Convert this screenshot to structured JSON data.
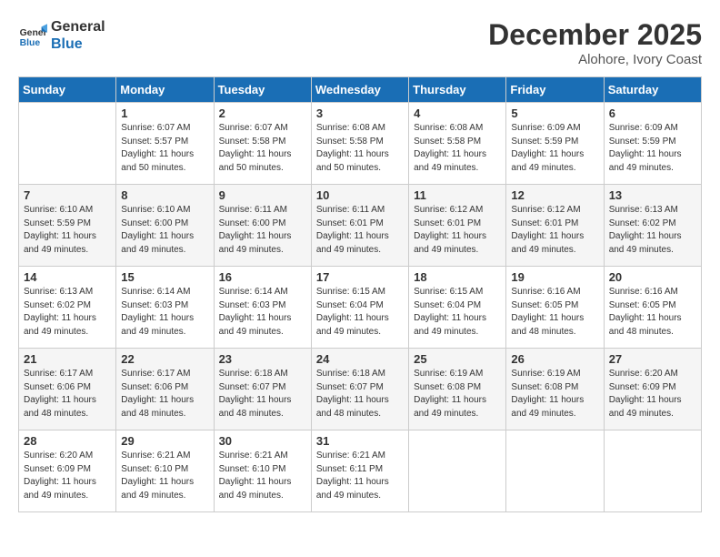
{
  "header": {
    "logo_line1": "General",
    "logo_line2": "Blue",
    "month": "December 2025",
    "location": "Alohore, Ivory Coast"
  },
  "days_of_week": [
    "Sunday",
    "Monday",
    "Tuesday",
    "Wednesday",
    "Thursday",
    "Friday",
    "Saturday"
  ],
  "weeks": [
    [
      {
        "day": "",
        "sunrise": "",
        "sunset": "",
        "daylight": ""
      },
      {
        "day": "1",
        "sunrise": "Sunrise: 6:07 AM",
        "sunset": "Sunset: 5:57 PM",
        "daylight": "Daylight: 11 hours and 50 minutes."
      },
      {
        "day": "2",
        "sunrise": "Sunrise: 6:07 AM",
        "sunset": "Sunset: 5:58 PM",
        "daylight": "Daylight: 11 hours and 50 minutes."
      },
      {
        "day": "3",
        "sunrise": "Sunrise: 6:08 AM",
        "sunset": "Sunset: 5:58 PM",
        "daylight": "Daylight: 11 hours and 50 minutes."
      },
      {
        "day": "4",
        "sunrise": "Sunrise: 6:08 AM",
        "sunset": "Sunset: 5:58 PM",
        "daylight": "Daylight: 11 hours and 49 minutes."
      },
      {
        "day": "5",
        "sunrise": "Sunrise: 6:09 AM",
        "sunset": "Sunset: 5:59 PM",
        "daylight": "Daylight: 11 hours and 49 minutes."
      },
      {
        "day": "6",
        "sunrise": "Sunrise: 6:09 AM",
        "sunset": "Sunset: 5:59 PM",
        "daylight": "Daylight: 11 hours and 49 minutes."
      }
    ],
    [
      {
        "day": "7",
        "sunrise": "Sunrise: 6:10 AM",
        "sunset": "Sunset: 5:59 PM",
        "daylight": "Daylight: 11 hours and 49 minutes."
      },
      {
        "day": "8",
        "sunrise": "Sunrise: 6:10 AM",
        "sunset": "Sunset: 6:00 PM",
        "daylight": "Daylight: 11 hours and 49 minutes."
      },
      {
        "day": "9",
        "sunrise": "Sunrise: 6:11 AM",
        "sunset": "Sunset: 6:00 PM",
        "daylight": "Daylight: 11 hours and 49 minutes."
      },
      {
        "day": "10",
        "sunrise": "Sunrise: 6:11 AM",
        "sunset": "Sunset: 6:01 PM",
        "daylight": "Daylight: 11 hours and 49 minutes."
      },
      {
        "day": "11",
        "sunrise": "Sunrise: 6:12 AM",
        "sunset": "Sunset: 6:01 PM",
        "daylight": "Daylight: 11 hours and 49 minutes."
      },
      {
        "day": "12",
        "sunrise": "Sunrise: 6:12 AM",
        "sunset": "Sunset: 6:01 PM",
        "daylight": "Daylight: 11 hours and 49 minutes."
      },
      {
        "day": "13",
        "sunrise": "Sunrise: 6:13 AM",
        "sunset": "Sunset: 6:02 PM",
        "daylight": "Daylight: 11 hours and 49 minutes."
      }
    ],
    [
      {
        "day": "14",
        "sunrise": "Sunrise: 6:13 AM",
        "sunset": "Sunset: 6:02 PM",
        "daylight": "Daylight: 11 hours and 49 minutes."
      },
      {
        "day": "15",
        "sunrise": "Sunrise: 6:14 AM",
        "sunset": "Sunset: 6:03 PM",
        "daylight": "Daylight: 11 hours and 49 minutes."
      },
      {
        "day": "16",
        "sunrise": "Sunrise: 6:14 AM",
        "sunset": "Sunset: 6:03 PM",
        "daylight": "Daylight: 11 hours and 49 minutes."
      },
      {
        "day": "17",
        "sunrise": "Sunrise: 6:15 AM",
        "sunset": "Sunset: 6:04 PM",
        "daylight": "Daylight: 11 hours and 49 minutes."
      },
      {
        "day": "18",
        "sunrise": "Sunrise: 6:15 AM",
        "sunset": "Sunset: 6:04 PM",
        "daylight": "Daylight: 11 hours and 49 minutes."
      },
      {
        "day": "19",
        "sunrise": "Sunrise: 6:16 AM",
        "sunset": "Sunset: 6:05 PM",
        "daylight": "Daylight: 11 hours and 48 minutes."
      },
      {
        "day": "20",
        "sunrise": "Sunrise: 6:16 AM",
        "sunset": "Sunset: 6:05 PM",
        "daylight": "Daylight: 11 hours and 48 minutes."
      }
    ],
    [
      {
        "day": "21",
        "sunrise": "Sunrise: 6:17 AM",
        "sunset": "Sunset: 6:06 PM",
        "daylight": "Daylight: 11 hours and 48 minutes."
      },
      {
        "day": "22",
        "sunrise": "Sunrise: 6:17 AM",
        "sunset": "Sunset: 6:06 PM",
        "daylight": "Daylight: 11 hours and 48 minutes."
      },
      {
        "day": "23",
        "sunrise": "Sunrise: 6:18 AM",
        "sunset": "Sunset: 6:07 PM",
        "daylight": "Daylight: 11 hours and 48 minutes."
      },
      {
        "day": "24",
        "sunrise": "Sunrise: 6:18 AM",
        "sunset": "Sunset: 6:07 PM",
        "daylight": "Daylight: 11 hours and 48 minutes."
      },
      {
        "day": "25",
        "sunrise": "Sunrise: 6:19 AM",
        "sunset": "Sunset: 6:08 PM",
        "daylight": "Daylight: 11 hours and 49 minutes."
      },
      {
        "day": "26",
        "sunrise": "Sunrise: 6:19 AM",
        "sunset": "Sunset: 6:08 PM",
        "daylight": "Daylight: 11 hours and 49 minutes."
      },
      {
        "day": "27",
        "sunrise": "Sunrise: 6:20 AM",
        "sunset": "Sunset: 6:09 PM",
        "daylight": "Daylight: 11 hours and 49 minutes."
      }
    ],
    [
      {
        "day": "28",
        "sunrise": "Sunrise: 6:20 AM",
        "sunset": "Sunset: 6:09 PM",
        "daylight": "Daylight: 11 hours and 49 minutes."
      },
      {
        "day": "29",
        "sunrise": "Sunrise: 6:21 AM",
        "sunset": "Sunset: 6:10 PM",
        "daylight": "Daylight: 11 hours and 49 minutes."
      },
      {
        "day": "30",
        "sunrise": "Sunrise: 6:21 AM",
        "sunset": "Sunset: 6:10 PM",
        "daylight": "Daylight: 11 hours and 49 minutes."
      },
      {
        "day": "31",
        "sunrise": "Sunrise: 6:21 AM",
        "sunset": "Sunset: 6:11 PM",
        "daylight": "Daylight: 11 hours and 49 minutes."
      },
      {
        "day": "",
        "sunrise": "",
        "sunset": "",
        "daylight": ""
      },
      {
        "day": "",
        "sunrise": "",
        "sunset": "",
        "daylight": ""
      },
      {
        "day": "",
        "sunrise": "",
        "sunset": "",
        "daylight": ""
      }
    ]
  ]
}
